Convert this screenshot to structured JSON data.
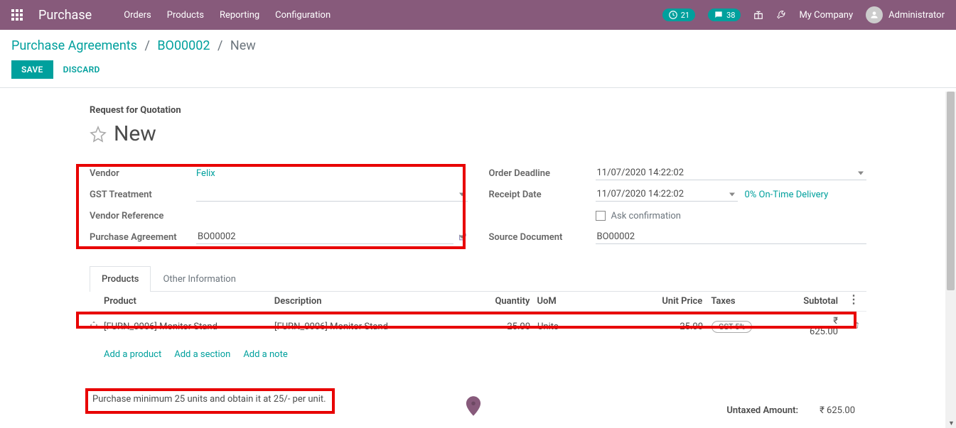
{
  "topbar": {
    "brand": "Purchase",
    "menu": [
      "Orders",
      "Products",
      "Reporting",
      "Configuration"
    ],
    "activity_count": "21",
    "message_count": "38",
    "company": "My Company",
    "user": "Administrator"
  },
  "breadcrumb": {
    "a": "Purchase Agreements",
    "b": "BO00002",
    "c": "New"
  },
  "buttons": {
    "save": "SAVE",
    "discard": "DISCARD"
  },
  "form": {
    "section": "Request for Quotation",
    "title": "New",
    "left": {
      "vendor_label": "Vendor",
      "vendor_value": "Felix",
      "gst_label": "GST Treatment",
      "gst_value": "",
      "ref_label": "Vendor Reference",
      "ref_value": "",
      "agree_label": "Purchase Agreement",
      "agree_value": "BO00002"
    },
    "right": {
      "deadline_label": "Order Deadline",
      "deadline_value": "11/07/2020 14:22:02",
      "receipt_label": "Receipt Date",
      "receipt_value": "11/07/2020 14:22:02",
      "ontime": "0% On-Time Delivery",
      "ask_label": "Ask confirmation",
      "source_label": "Source Document",
      "source_value": "BO00002"
    }
  },
  "tabs": {
    "a": "Products",
    "b": "Other Information"
  },
  "table": {
    "h_product": "Product",
    "h_desc": "Description",
    "h_qty": "Quantity",
    "h_uom": "UoM",
    "h_price": "Unit Price",
    "h_tax": "Taxes",
    "h_sub": "Subtotal",
    "r_product": "[FURN_0006] Monitor Stand",
    "r_desc": "[FURN_0006] Monitor Stand",
    "r_qty": "25.00",
    "r_uom": "Units",
    "r_price": "25.00",
    "r_tax": "GST 5%",
    "r_sub": "₹ 625.00",
    "add_product": "Add a product",
    "add_section": "Add a section",
    "add_note": "Add a note"
  },
  "note": "Purchase minimum 25 units  and obtain it at 25/- per unit.",
  "totals": {
    "untaxed_label": "Untaxed Amount:",
    "untaxed_value": "₹ 625.00"
  }
}
